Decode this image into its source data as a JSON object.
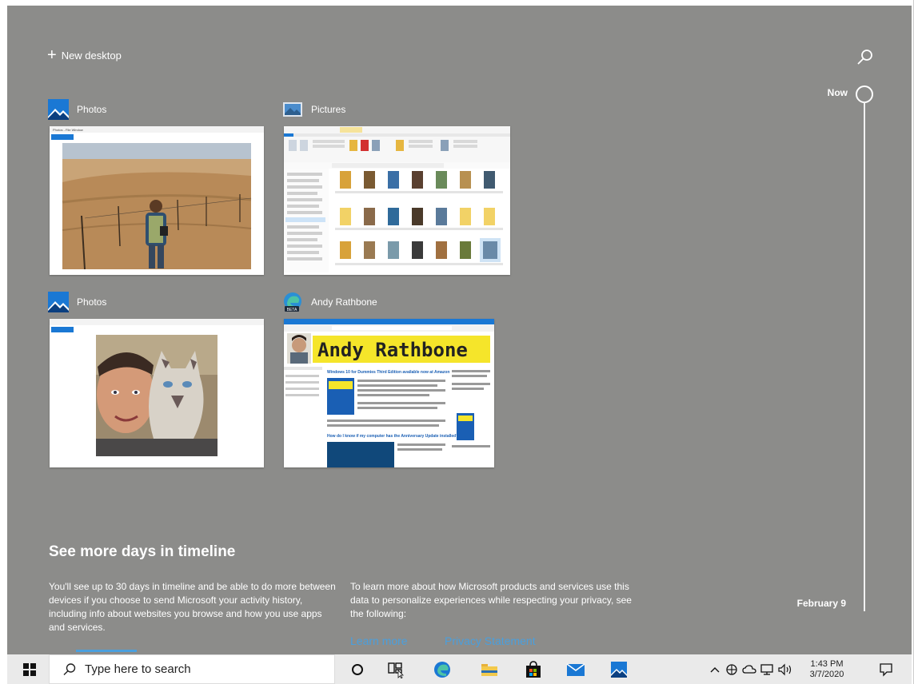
{
  "timeline": {
    "new_desktop_label": "New desktop",
    "now_label": "Now",
    "end_label": "February 9"
  },
  "activities": [
    {
      "app": "Photos",
      "icon": "photos-icon"
    },
    {
      "app": "Pictures",
      "icon": "file-explorer-icon"
    },
    {
      "app": "Photos",
      "icon": "photos-icon"
    },
    {
      "app": "Andy Rathbone",
      "icon": "edge-beta-icon"
    }
  ],
  "thumbs": {
    "photos1_title": "Photos - File Window",
    "pictures_folder": "Pictures",
    "andy_site_title": "Andy Rathbone",
    "andy_site_heading1": "Windows 10 for Dummies Third Edition available now at Amazon",
    "andy_site_heading2": "How do I know if my computer has the Anniversary Update installed?",
    "beta_badge": "BETA"
  },
  "more_days": {
    "title": "See more days in timeline",
    "left_text": "You'll see up to 30 days in timeline and be able to do more between devices if you choose to send Microsoft your activity history, including info about websites you browse and how you use apps and services.",
    "right_text": "To learn more about how Microsoft products and services use this data to personalize experiences while respecting your privacy, see the following:",
    "learn_more": "Learn more",
    "privacy": "Privacy Statement"
  },
  "taskbar": {
    "search_placeholder": "Type here to search",
    "time": "1:43 PM",
    "date": "3/7/2020"
  },
  "colors": {
    "timeline_bg": "#8c8c8a",
    "taskbar_bg": "#eaeaea",
    "link": "#4a9fdd",
    "andy_banner": "#f5e52a"
  }
}
